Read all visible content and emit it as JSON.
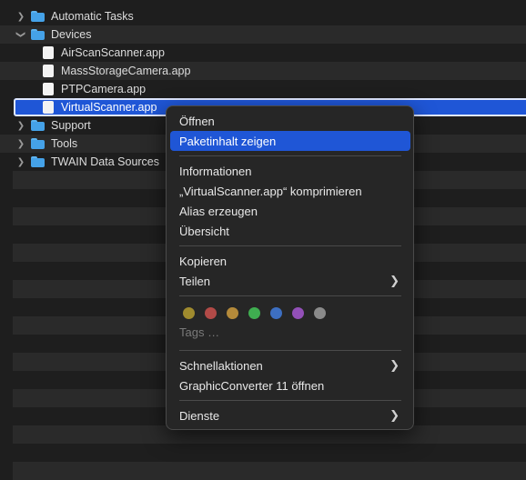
{
  "tree": {
    "rows": [
      {
        "label": "Automatic Tasks",
        "kind": "folder",
        "expanded": false
      },
      {
        "label": "Devices",
        "kind": "folder",
        "expanded": true
      },
      {
        "label": "AirScanScanner.app",
        "kind": "app"
      },
      {
        "label": "MassStorageCamera.app",
        "kind": "app"
      },
      {
        "label": "PTPCamera.app",
        "kind": "app"
      },
      {
        "label": "VirtualScanner.app",
        "kind": "app",
        "selected": true
      },
      {
        "label": "Support",
        "kind": "folder",
        "expanded": false
      },
      {
        "label": "Tools",
        "kind": "folder",
        "expanded": false
      },
      {
        "label": "TWAIN Data Sources",
        "kind": "folder",
        "expanded": false
      }
    ]
  },
  "context_menu": {
    "open": "Öffnen",
    "show_package": "Paketinhalt zeigen",
    "info": "Informationen",
    "compress": "„VirtualScanner.app“ komprimieren",
    "alias": "Alias erzeugen",
    "overview": "Übersicht",
    "copy": "Kopieren",
    "share": "Teilen",
    "tags_placeholder": "Tags …",
    "tag_colors": [
      "#a08b2e",
      "#b24a47",
      "#b48a3a",
      "#3fae50",
      "#3d6fc2",
      "#9350b8",
      "#8a8a8a"
    ],
    "quick_actions": "Schnellaktionen",
    "graphic_converter": "GraphicConverter 11 öffnen",
    "services": "Dienste"
  },
  "colors": {
    "accent": "#1f56d6",
    "folder": "#45a2e8"
  }
}
